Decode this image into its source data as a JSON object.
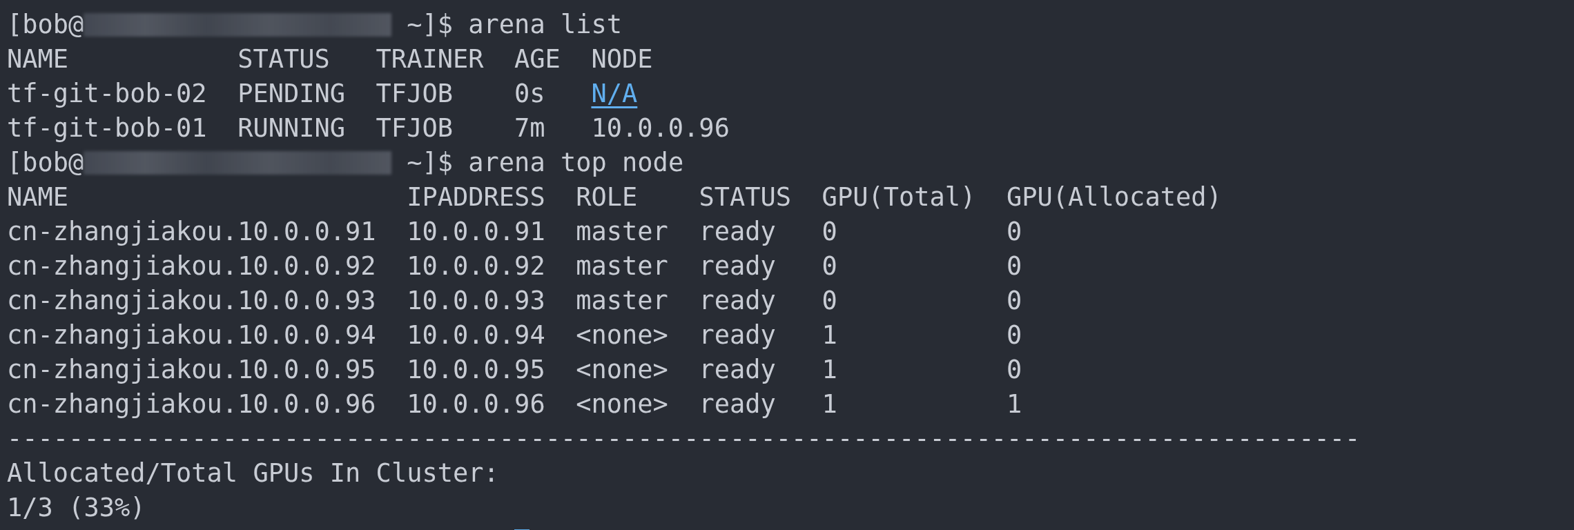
{
  "terminal": {
    "blocks": [
      {
        "kind": "prompt",
        "user": "[bob@",
        "tail": " ~]$",
        "command": "arena list"
      },
      {
        "kind": "table",
        "columns": [
          "NAME",
          "STATUS",
          "TRAINER",
          "AGE",
          "NODE"
        ],
        "rows": [
          [
            "tf-git-bob-02",
            "PENDING",
            "TFJOB",
            "0s",
            {
              "kind": "link",
              "text": "N/A"
            }
          ],
          [
            "tf-git-bob-01",
            "RUNNING",
            "TFJOB",
            "7m",
            "10.0.0.96"
          ]
        ]
      },
      {
        "kind": "prompt",
        "user": "[bob@",
        "tail": " ~]$",
        "command": "arena top node"
      },
      {
        "kind": "table",
        "columns": [
          "NAME",
          "IPADDRESS",
          "ROLE",
          "STATUS",
          "GPU(Total)",
          "GPU(Allocated)"
        ],
        "rows": [
          [
            "cn-zhangjiakou.10.0.0.91",
            "10.0.0.91",
            "master",
            "ready",
            "0",
            "0"
          ],
          [
            "cn-zhangjiakou.10.0.0.92",
            "10.0.0.92",
            "master",
            "ready",
            "0",
            "0"
          ],
          [
            "cn-zhangjiakou.10.0.0.93",
            "10.0.0.93",
            "master",
            "ready",
            "0",
            "0"
          ],
          [
            "cn-zhangjiakou.10.0.0.94",
            "10.0.0.94",
            "<none>",
            "ready",
            "1",
            "0"
          ],
          [
            "cn-zhangjiakou.10.0.0.95",
            "10.0.0.95",
            "<none>",
            "ready",
            "1",
            "0"
          ],
          [
            "cn-zhangjiakou.10.0.0.96",
            "10.0.0.96",
            "<none>",
            "ready",
            "1",
            "1"
          ]
        ]
      },
      {
        "kind": "rule",
        "text": "----------------------------------------------------------------------------------------"
      },
      {
        "kind": "text",
        "text": "Allocated/Total GPUs In Cluster:"
      },
      {
        "kind": "text",
        "text": "1/3 (33%)"
      },
      {
        "kind": "cursor"
      }
    ]
  }
}
